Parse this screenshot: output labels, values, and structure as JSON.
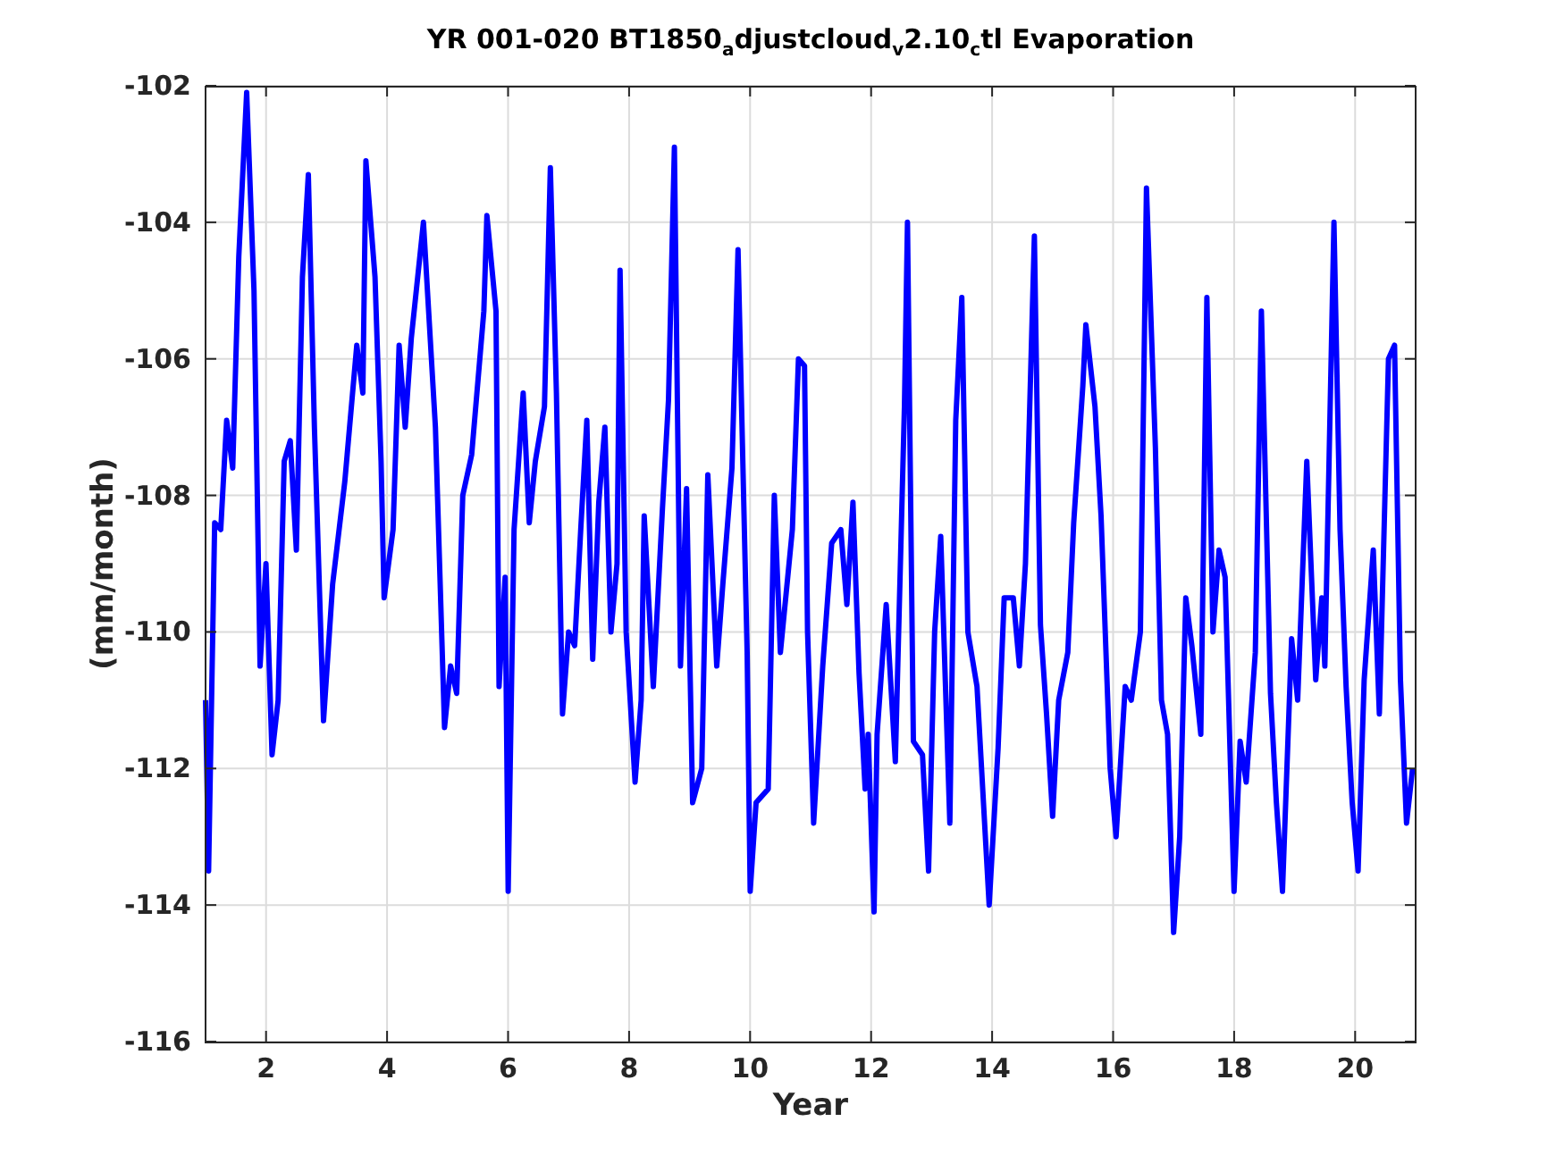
{
  "figure": {
    "title": "YR 001-020 BT1850$_{a}$djustcloud$_{v}$2.10$_{c}$tl Evaporation",
    "chart_data": {
      "type": "line",
      "grid": true,
      "xlabel": "Year",
      "ylabel": "(mm/month)",
      "xlim": [
        1,
        21
      ],
      "ylim": [
        -116,
        -102
      ],
      "xticks": [
        2,
        4,
        6,
        8,
        10,
        12,
        14,
        16,
        18,
        20
      ],
      "yticks": [
        -116,
        -114,
        -112,
        -110,
        -108,
        -106,
        -104,
        -102
      ],
      "x": [
        1.0,
        1.05,
        1.15,
        1.25,
        1.35,
        1.45,
        1.55,
        1.68,
        1.8,
        1.9,
        2.0,
        2.1,
        2.2,
        2.3,
        2.4,
        2.5,
        2.6,
        2.7,
        2.8,
        2.95,
        3.1,
        3.3,
        3.5,
        3.6,
        3.65,
        3.8,
        3.9,
        3.95,
        4.1,
        4.2,
        4.3,
        4.4,
        4.6,
        4.8,
        4.95,
        5.05,
        5.15,
        5.25,
        5.4,
        5.6,
        5.65,
        5.8,
        5.85,
        5.95,
        6.0,
        6.1,
        6.25,
        6.35,
        6.45,
        6.6,
        6.7,
        6.8,
        6.9,
        7.0,
        7.1,
        7.2,
        7.3,
        7.4,
        7.5,
        7.6,
        7.7,
        7.8,
        7.85,
        7.95,
        8.1,
        8.2,
        8.25,
        8.4,
        8.55,
        8.65,
        8.75,
        8.85,
        8.95,
        9.05,
        9.2,
        9.3,
        9.45,
        9.55,
        9.7,
        9.8,
        9.95,
        10.0,
        10.1,
        10.3,
        10.4,
        10.5,
        10.7,
        10.8,
        10.9,
        10.95,
        11.05,
        11.2,
        11.35,
        11.5,
        11.6,
        11.7,
        11.8,
        11.9,
        11.95,
        12.05,
        12.1,
        12.25,
        12.4,
        12.55,
        12.6,
        12.7,
        12.85,
        12.95,
        13.05,
        13.15,
        13.3,
        13.4,
        13.5,
        13.6,
        13.75,
        13.95,
        14.1,
        14.2,
        14.35,
        14.45,
        14.55,
        14.7,
        14.8,
        14.9,
        15.0,
        15.1,
        15.25,
        15.35,
        15.5,
        15.55,
        15.7,
        15.8,
        15.95,
        16.05,
        16.2,
        16.3,
        16.45,
        16.55,
        16.7,
        16.8,
        16.9,
        17.0,
        17.1,
        17.2,
        17.3,
        17.45,
        17.55,
        17.65,
        17.75,
        17.85,
        18.0,
        18.1,
        18.2,
        18.35,
        18.45,
        18.6,
        18.7,
        18.8,
        18.95,
        19.05,
        19.2,
        19.35,
        19.45,
        19.5,
        19.65,
        19.75,
        19.85,
        19.95,
        20.05,
        20.15,
        20.3,
        20.4,
        20.55,
        20.65,
        20.75,
        20.85,
        20.95
      ],
      "series": [
        {
          "color": "#0000ff",
          "values": [
            -111.0,
            -113.5,
            -108.4,
            -108.5,
            -106.9,
            -107.6,
            -104.5,
            -102.1,
            -105.0,
            -110.5,
            -109.0,
            -111.8,
            -111.0,
            -107.5,
            -107.2,
            -108.8,
            -104.8,
            -103.3,
            -107.0,
            -111.3,
            -109.3,
            -107.8,
            -105.8,
            -106.5,
            -103.1,
            -104.8,
            -107.5,
            -109.5,
            -108.5,
            -105.8,
            -107.0,
            -105.7,
            -104.0,
            -107.0,
            -111.4,
            -110.5,
            -110.9,
            -108.0,
            -107.4,
            -105.3,
            -103.9,
            -105.3,
            -110.8,
            -109.2,
            -113.8,
            -108.5,
            -106.5,
            -108.4,
            -107.5,
            -106.7,
            -103.2,
            -106.5,
            -111.2,
            -110.0,
            -110.2,
            -108.5,
            -106.9,
            -110.4,
            -108.1,
            -107.0,
            -110.0,
            -109.0,
            -104.7,
            -110.0,
            -112.2,
            -111.0,
            -108.3,
            -110.8,
            -108.2,
            -106.6,
            -102.9,
            -110.5,
            -107.9,
            -112.5,
            -112.0,
            -107.7,
            -110.5,
            -109.3,
            -107.6,
            -104.4,
            -110.3,
            -113.8,
            -112.5,
            -112.3,
            -108.0,
            -110.3,
            -108.5,
            -106.0,
            -106.1,
            -110.0,
            -112.8,
            -110.5,
            -108.7,
            -108.5,
            -109.6,
            -108.1,
            -110.6,
            -112.3,
            -111.5,
            -114.1,
            -111.5,
            -109.6,
            -111.9,
            -106.7,
            -104.0,
            -111.6,
            -111.8,
            -113.5,
            -110.0,
            -108.6,
            -112.8,
            -106.9,
            -105.1,
            -110.0,
            -110.8,
            -114.0,
            -111.7,
            -109.5,
            -109.5,
            -110.5,
            -109.0,
            -104.2,
            -109.9,
            -111.2,
            -112.7,
            -111.0,
            -110.3,
            -108.4,
            -106.4,
            -105.5,
            -106.7,
            -108.3,
            -112.0,
            -113.0,
            -110.8,
            -111.0,
            -110.0,
            -103.5,
            -107.3,
            -111.0,
            -111.5,
            -114.4,
            -113.0,
            -109.5,
            -110.2,
            -111.5,
            -105.1,
            -110.0,
            -108.8,
            -109.2,
            -113.8,
            -111.6,
            -112.2,
            -110.3,
            -105.3,
            -110.9,
            -112.5,
            -113.8,
            -110.1,
            -111.0,
            -107.5,
            -110.7,
            -109.5,
            -110.5,
            -104.0,
            -108.5,
            -110.8,
            -112.5,
            -113.5,
            -110.7,
            -108.8,
            -111.2,
            -106.0,
            -105.8,
            -110.7,
            -112.8,
            -112.0
          ]
        }
      ]
    }
  }
}
